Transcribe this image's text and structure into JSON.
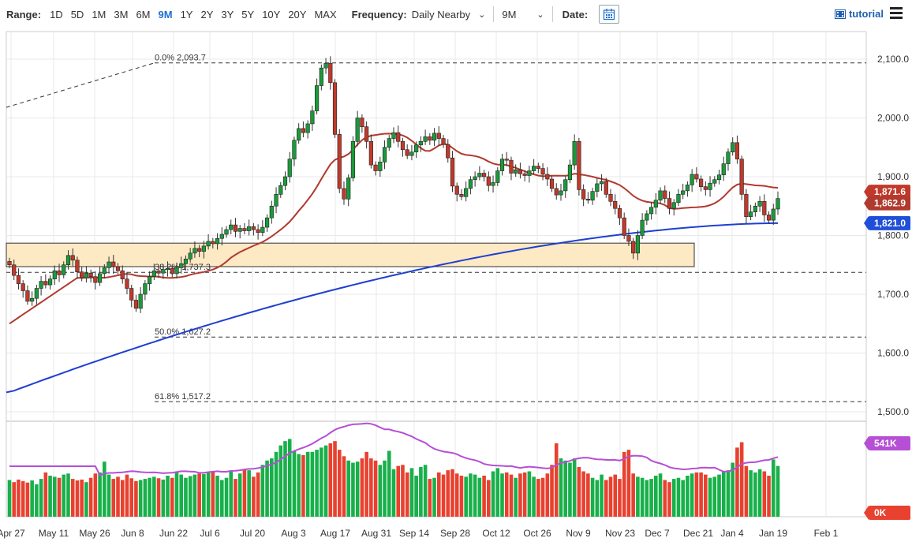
{
  "toolbar": {
    "range_label": "Range:",
    "ranges": [
      "1D",
      "5D",
      "1M",
      "3M",
      "6M",
      "9M",
      "1Y",
      "2Y",
      "3Y",
      "5Y",
      "10Y",
      "20Y",
      "MAX"
    ],
    "active_range": "9M",
    "frequency_label": "Frequency:",
    "frequency_value": "Daily Nearby",
    "period_value": "9M",
    "date_label": "Date:",
    "tutorial_label": "tutorial"
  },
  "chart_data": {
    "type": "candlestick",
    "price_axis": {
      "ticks": [
        "2,100.0",
        "2,000.0",
        "1,900.0",
        "1,800.0",
        "1,700.0",
        "1,600.0",
        "1,500.0"
      ],
      "tick_values": [
        2100,
        2000,
        1900,
        1800,
        1700,
        1600,
        1500
      ],
      "range": [
        1480,
        2130
      ]
    },
    "volume_axis": {
      "ticks": [
        "541K",
        "0K"
      ]
    },
    "x_axis": {
      "ticks": [
        "Apr 27",
        "May 11",
        "May 26",
        "Jun 8",
        "Jun 22",
        "Jul 6",
        "Jul 20",
        "Aug 3",
        "Aug 17",
        "Aug 31",
        "Sep 14",
        "Sep 28",
        "Oct 12",
        "Oct 26",
        "Nov 9",
        "Nov 23",
        "Dec 7",
        "Dec 21",
        "Jan 4",
        "Jan 19",
        "Feb 1"
      ]
    },
    "last_price": "1,862.9",
    "ma_labels": [
      {
        "value": "1,871.6",
        "color": "#c0392b"
      },
      {
        "value": "1,821.0",
        "color": "#1f4fd8"
      }
    ],
    "fibonacci": [
      {
        "label": "0.0% 2,093.7",
        "value": 2093.7
      },
      {
        "label": "38.2% 1,737.3",
        "value": 1737.3
      },
      {
        "label": "50.0% 1,627.2",
        "value": 1627.2
      },
      {
        "label": "61.8% 1,517.2",
        "value": 1517.2
      }
    ],
    "zone": {
      "from": 1747,
      "to": 1787
    },
    "trend_line": {
      "from": [
        0,
        2018
      ],
      "to": [
        13,
        2093.7
      ]
    },
    "closes": [
      1750,
      1732,
      1718,
      1706,
      1688,
      1693,
      1710,
      1722,
      1716,
      1726,
      1740,
      1733,
      1750,
      1766,
      1758,
      1738,
      1728,
      1736,
      1730,
      1720,
      1735,
      1745,
      1755,
      1747,
      1740,
      1726,
      1710,
      1690,
      1676,
      1700,
      1718,
      1730,
      1740,
      1736,
      1742,
      1744,
      1735,
      1745,
      1752,
      1760,
      1770,
      1778,
      1773,
      1782,
      1790,
      1786,
      1795,
      1802,
      1810,
      1818,
      1807,
      1812,
      1808,
      1815,
      1810,
      1805,
      1814,
      1830,
      1850,
      1870,
      1885,
      1900,
      1930,
      1962,
      1982,
      1975,
      1990,
      2012,
      2055,
      2085,
      2093,
      2060,
      1972,
      1880,
      1862,
      1898,
      1960,
      2000,
      1985,
      1960,
      1920,
      1910,
      1925,
      1950,
      1965,
      1975,
      1960,
      1946,
      1936,
      1942,
      1954,
      1960,
      1968,
      1962,
      1974,
      1965,
      1955,
      1932,
      1884,
      1870,
      1866,
      1880,
      1895,
      1900,
      1906,
      1900,
      1885,
      1890,
      1910,
      1930,
      1928,
      1906,
      1912,
      1905,
      1902,
      1910,
      1918,
      1914,
      1904,
      1896,
      1880,
      1869,
      1876,
      1895,
      1920,
      1960,
      1878,
      1862,
      1860,
      1875,
      1888,
      1892,
      1870,
      1858,
      1846,
      1830,
      1800,
      1790,
      1770,
      1800,
      1826,
      1837,
      1848,
      1860,
      1876,
      1863,
      1846,
      1856,
      1870,
      1876,
      1886,
      1904,
      1896,
      1883,
      1878,
      1889,
      1895,
      1903,
      1922,
      1942,
      1958,
      1930,
      1870,
      1832,
      1840,
      1850,
      1858,
      1835,
      1826,
      1845,
      1862.9
    ],
    "volume": [
      170,
      160,
      172,
      165,
      158,
      168,
      150,
      175,
      205,
      190,
      185,
      180,
      195,
      200,
      175,
      168,
      172,
      160,
      180,
      200,
      205,
      255,
      195,
      175,
      185,
      170,
      195,
      178,
      165,
      170,
      175,
      180,
      185,
      178,
      172,
      190,
      180,
      210,
      195,
      180,
      188,
      195,
      200,
      198,
      205,
      210,
      190,
      170,
      180,
      210,
      175,
      200,
      220,
      215,
      185,
      205,
      240,
      260,
      270,
      300,
      330,
      350,
      360,
      305,
      290,
      285,
      300,
      300,
      310,
      320,
      330,
      340,
      350,
      310,
      280,
      260,
      250,
      255,
      270,
      300,
      270,
      260,
      240,
      260,
      305,
      220,
      235,
      240,
      205,
      225,
      190,
      230,
      240,
      175,
      180,
      205,
      195,
      215,
      220,
      200,
      190,
      185,
      200,
      195,
      180,
      190,
      170,
      210,
      225,
      200,
      205,
      195,
      180,
      200,
      205,
      210,
      185,
      175,
      180,
      200,
      240,
      340,
      270,
      260,
      250,
      270,
      230,
      210,
      200,
      180,
      170,
      195,
      170,
      185,
      195,
      175,
      300,
      310,
      200,
      185,
      180,
      170,
      175,
      190,
      200,
      170,
      160,
      175,
      180,
      170,
      190,
      200,
      205,
      205,
      195,
      180,
      185,
      195,
      210,
      215,
      250,
      320,
      345,
      235,
      215,
      205,
      220,
      210,
      190,
      265,
      235
    ]
  }
}
